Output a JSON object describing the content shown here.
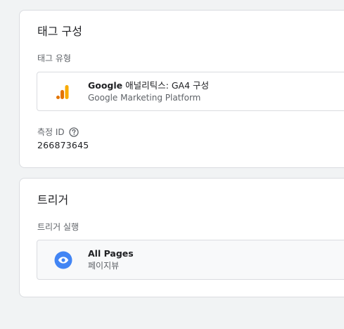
{
  "tag_config": {
    "title": "태그 구성",
    "type_label": "태그 유형",
    "tag_type": {
      "name_bold": "Google",
      "name_rest": "애널리틱스: GA4 구성",
      "vendor": "Google Marketing Platform",
      "icon": "google-analytics-icon",
      "icon_color": "#f9ab00",
      "icon_color_dark": "#e37400"
    },
    "measurement_id_label": "측정 ID",
    "measurement_id_value": "266873645",
    "help_icon": "help-circle-icon"
  },
  "triggers": {
    "title": "트리거",
    "firing_label": "트리거 실행",
    "items": [
      {
        "name": "All Pages",
        "type": "페이지뷰",
        "icon": "eye-icon",
        "icon_color": "#4285f4"
      }
    ]
  }
}
